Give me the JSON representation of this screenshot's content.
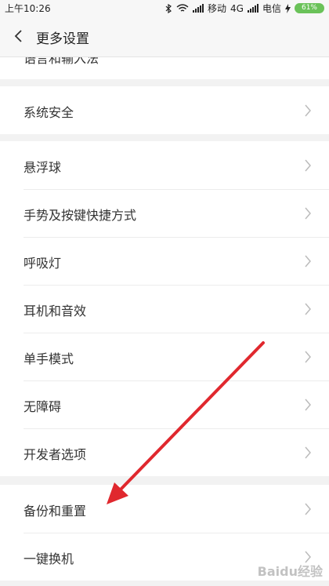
{
  "status_bar": {
    "time": "上午10:26",
    "carrier1": "移动",
    "network": "4G",
    "carrier2": "电信",
    "battery": "61%"
  },
  "header": {
    "back_icon": "chevron-left-icon",
    "title": "更多设置"
  },
  "partial_item": {
    "label": "语言和输入法"
  },
  "groups": [
    {
      "items": [
        {
          "label": "系统安全"
        }
      ]
    },
    {
      "items": [
        {
          "label": "悬浮球"
        },
        {
          "label": "手势及按键快捷方式"
        },
        {
          "label": "呼吸灯"
        },
        {
          "label": "耳机和音效"
        },
        {
          "label": "单手模式"
        },
        {
          "label": "无障碍"
        },
        {
          "label": "开发者选项"
        }
      ]
    },
    {
      "items": [
        {
          "label": "备份和重置"
        },
        {
          "label": "一键换机"
        }
      ]
    }
  ],
  "annotation": {
    "color": "#e0282e",
    "points_to": "备份和重置"
  },
  "watermark": {
    "text": "Baidu经验"
  },
  "colors": {
    "background": "#f2f2f2",
    "battery": "#6ac259",
    "annotation": "#e0282e"
  }
}
